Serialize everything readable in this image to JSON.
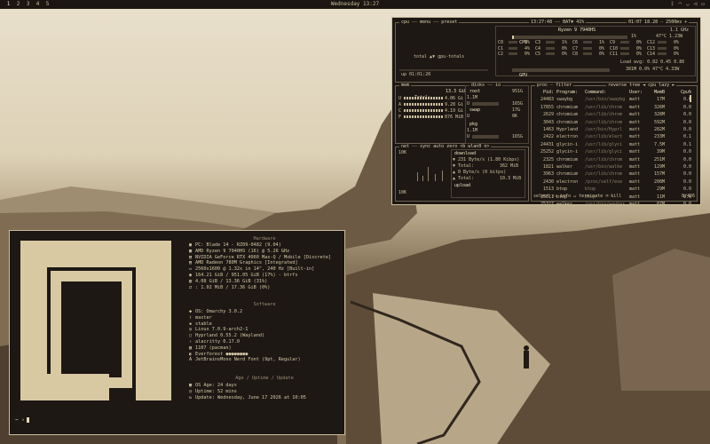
{
  "topbar": {
    "workspaces": [
      "1",
      "2",
      "3",
      "4",
      "5"
    ],
    "active_workspace": "1",
    "clock": "Wednesday 13:27",
    "status_icons": [
      "bluetooth-icon",
      "wifi-icon",
      "headphones-icon",
      "volume-icon",
      "battery-icon"
    ]
  },
  "btop": {
    "header_left": "cpu",
    "header_menu": "menu",
    "header_preset": "preset",
    "header_time": "13:27:48",
    "header_bat": "BAT▼ 41%",
    "header_uptime": "01:07 18.28",
    "header_freq": "2500ms +",
    "cpu_model": "Ryzen 9 7940HS",
    "cpu_freq": "1.1 GHz",
    "cpu_label": "CPU",
    "cpu_pct": "1%",
    "cpu_temp": "47°C 1.23W",
    "cores": [
      {
        "a": "C0",
        "ap": "1%",
        "b": "C3",
        "bp": "1%",
        "c": "C6",
        "cp": "1%",
        "d": "C9",
        "dp": "0%",
        "e": "C12",
        "ep": "0%"
      },
      {
        "a": "C1",
        "ap": "4%",
        "b": "C4",
        "bp": "0%",
        "c": "C7",
        "cp": "0%",
        "d": "C10",
        "dp": "0%",
        "e": "C13",
        "ep": "0%"
      },
      {
        "a": "C2",
        "ap": "0%",
        "b": "C5",
        "bp": "0%",
        "c": "C8",
        "cp": "0%",
        "d": "C11",
        "dp": "0%",
        "e": "C14",
        "ep": "0%"
      }
    ],
    "load_avg": "Load avg: 0.82 0.45 0.86",
    "gpu_label": "GPU",
    "gpu_line": "381M 0.0% 47°C 4.33W",
    "graph_label": "total ▲▼ gpu-totals",
    "uptime": "up 01:01:20",
    "mem": {
      "title": "mem",
      "total_label": "Total:",
      "total": "13.3 GiB",
      "rows": [
        {
          "k": "U",
          "v": "4.06 Gi"
        },
        {
          "k": "A",
          "v": "9.28 Gi"
        },
        {
          "k": "C",
          "v": "4.19 Gi"
        },
        {
          "k": "F",
          "v": "876 MiB"
        }
      ]
    },
    "disks": {
      "title": "disks",
      "io": "io",
      "root_label": "root",
      "root_size": "951G",
      "root_used_label": "1.1M",
      "root_used": "165G",
      "swap_label": "swap",
      "swap_size": "17G",
      "swap_used": "0K",
      "pkg_label": "pkg",
      "pkg_used_label": "1.1M",
      "pkg_used": "165G"
    },
    "net": {
      "title": "net",
      "menu": "sync auto zero <b wlan0 n>",
      "scale_top": "10K",
      "scale_bottom": "10K",
      "download_label": "download",
      "down_rate": "231 Byte/s (1.80 Kibps)",
      "down_rate2": "0 Byte/s (0 bitps)",
      "total_label": "Total:",
      "down_total": "362 MiB",
      "up_total": "10.3 MiB",
      "upload_label": "upload"
    },
    "proc": {
      "title": "proc",
      "filter": "filter",
      "options": "reverse tree ◄ cpu lazy ►",
      "headers": [
        "Pid:",
        "Program:",
        "Command:",
        "User:",
        "MemB",
        "Cpu%"
      ],
      "rows": [
        [
          "24483",
          "swaybg",
          "/usr/bin/swaybg",
          "matt",
          "17M",
          "0.0"
        ],
        [
          "17855",
          "chromium",
          "/usr/lib/chrom",
          "matt",
          "326M",
          "0.0"
        ],
        [
          "2629",
          "chromium",
          "/usr/lib/chrom",
          "matt",
          "328M",
          "0.0"
        ],
        [
          "3043",
          "chromium",
          "/usr/lib/chrom",
          "matt",
          "592M",
          "0.0"
        ],
        [
          "1463",
          "Hyprland",
          "/usr/bin/Hyprl",
          "matt",
          "282M",
          "0.0"
        ],
        [
          "2422",
          "electron",
          "/usr/lib/elect",
          "matt",
          "233M",
          "0.1"
        ],
        [
          "24431",
          "glycin-i",
          "/usr/lib/glyci",
          "matt",
          "7.5M",
          "0.1"
        ],
        [
          "25252",
          "glycin-i",
          "/usr/lib/glyci",
          "matt",
          "39M",
          "0.0"
        ],
        [
          "2325",
          "chromium",
          "/usr/lib/chrom",
          "matt",
          "251M",
          "0.0"
        ],
        [
          "1821",
          "walker",
          "/usr/bin/walke",
          "matt",
          "129M",
          "0.0"
        ],
        [
          "3963",
          "chromium",
          "/usr/lib/chrom",
          "matt",
          "157M",
          "0.0"
        ],
        [
          "2430",
          "electron",
          "/proc/self/exe",
          "matt",
          "208M",
          "0.0"
        ],
        [
          "1513",
          "btop",
          "btop",
          "matt",
          "29M",
          "0.0"
        ],
        [
          "15611",
          "btop",
          "btop",
          "matt",
          "11M",
          "0.0"
        ],
        [
          "25327",
          "walker",
          "/usr/bin/waybar",
          "matt",
          "87M",
          "0.0"
        ],
        [
          "32022",
          "chromium",
          "/usr/lib/chrom",
          "matt",
          "95M",
          "0.0"
        ]
      ],
      "footer_left": "select ↑↓ info ↵ terminate ⌫ kill",
      "footer_right": "0/426"
    }
  },
  "fastfetch": {
    "hardware_title": "Hardware",
    "hardware": [
      {
        "icon": "laptop-icon",
        "text": "PC: Blade 14 - RZ09-0482 (9.04)"
      },
      {
        "icon": "cpu-icon",
        "text": "AMD Ryzen 9 7940HS (16) @ 5.26 GHz"
      },
      {
        "icon": "gpu-icon",
        "text": "NVIDIA GeForce RTX 4060 Max-Q / Mobile [Discrete]"
      },
      {
        "icon": "gpu-icon",
        "text": "AMD Radeon 780M Graphics [Integrated]"
      },
      {
        "icon": "monitor-icon",
        "text": "2560x1600 @ 1.32x in 14\", 240 Hz [Built-in]"
      },
      {
        "icon": "disk-icon",
        "text": "164.21 GiB / 951.05 GiB (17%) - btrfs"
      },
      {
        "icon": "memory-icon",
        "text": "4.08 GiB / 13.36 GiB (31%)"
      },
      {
        "icon": "swap-icon",
        "text": ": 1.02 MiB / 17.36 GiB (0%)"
      }
    ],
    "software_title": "Software",
    "software": [
      {
        "icon": "os-icon",
        "text": "OS: Omarchy 3.0.2"
      },
      {
        "icon": "branch-icon",
        "text": "master"
      },
      {
        "icon": "channel-icon",
        "text": "stable"
      },
      {
        "icon": "kernel-icon",
        "text": "Linux 7.0.9-arch2-1"
      },
      {
        "icon": "wm-icon",
        "text": "Hyprland 0.55.2 (Wayland)"
      },
      {
        "icon": "terminal-icon",
        "text": "alacritty 0.17.0"
      },
      {
        "icon": "package-icon",
        "text": "1107 (pacman)"
      },
      {
        "icon": "theme-icon",
        "text": "Everforest ●●●●●●●●"
      },
      {
        "icon": "font-icon",
        "text": "JetBrainsMono Nerd Font (9pt, Regular)"
      }
    ],
    "age_title": "Age / Uptime / Update",
    "age": [
      {
        "icon": "calendar-icon",
        "text": "OS Age: 24 days"
      },
      {
        "icon": "clock-icon",
        "text": "Uptime: 52 mins"
      },
      {
        "icon": "update-icon",
        "text": "Update: Wednesday, June 17 2026 at 10:05"
      }
    ],
    "prompt": "~ ›"
  }
}
